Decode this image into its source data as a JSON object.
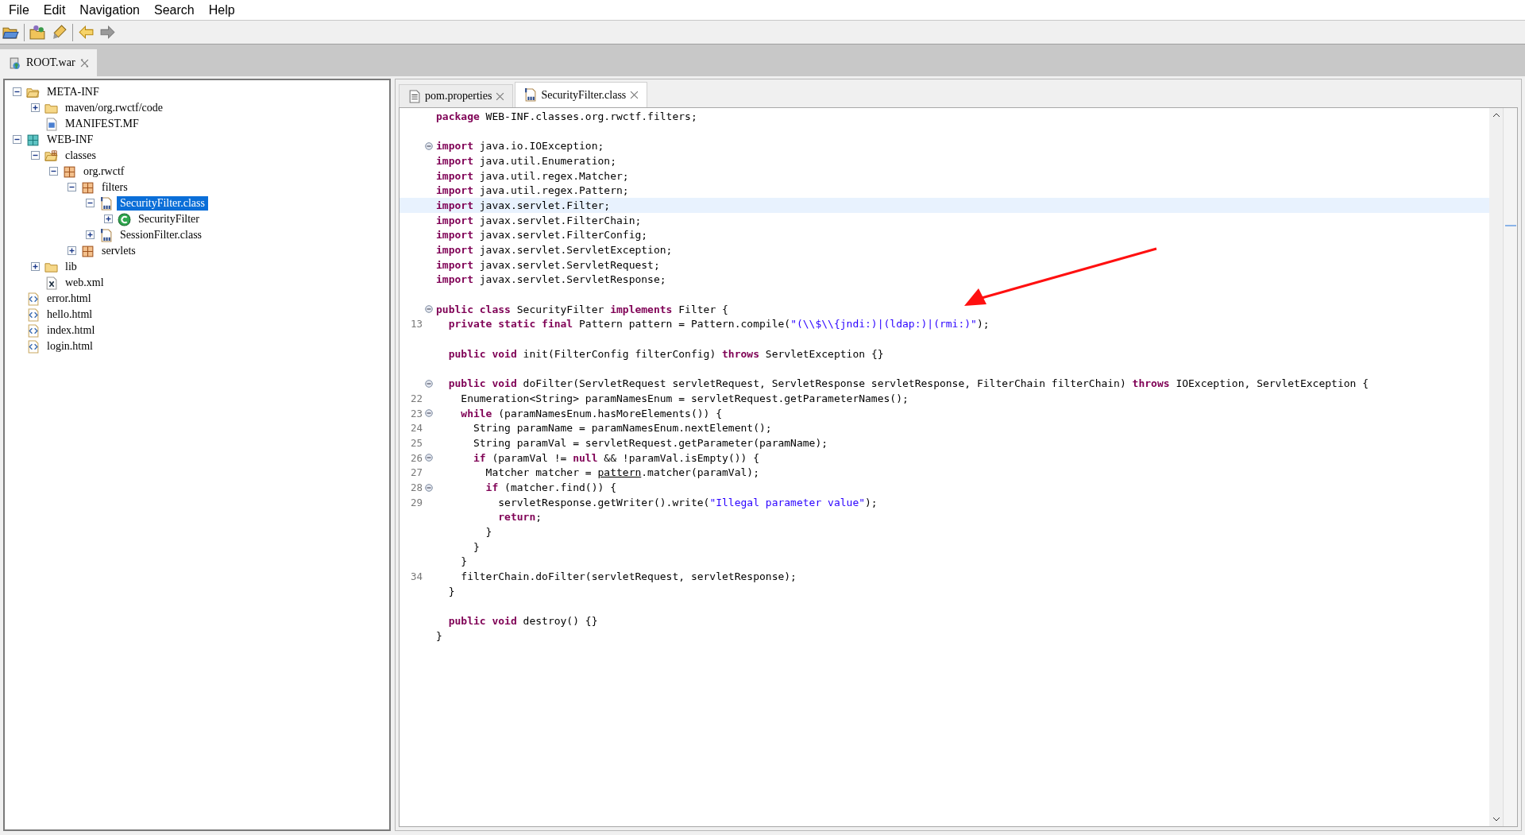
{
  "menu": [
    "File",
    "Edit",
    "Navigation",
    "Search",
    "Help"
  ],
  "toolbar": [
    {
      "kind": "open",
      "disabled": false
    },
    {
      "kind": "open-type",
      "disabled": false
    },
    {
      "kind": "declaration",
      "disabled": false
    },
    {
      "kind": "back",
      "disabled": false
    },
    {
      "kind": "forward",
      "disabled": true
    }
  ],
  "left_tabs": [
    {
      "label": "ROOT.war",
      "selected": true
    }
  ],
  "tree": [
    {
      "label": "META-INF",
      "kind": "folder",
      "expanded": true,
      "selected": false,
      "children": [
        {
          "label": "maven/org.rwctf/code",
          "kind": "folder",
          "expanded": false,
          "selected": false
        },
        {
          "label": "MANIFEST.MF",
          "kind": "manifest",
          "selected": false
        }
      ]
    },
    {
      "label": "WEB-INF",
      "kind": "webinf",
      "expanded": true,
      "selected": false,
      "children": [
        {
          "label": "classes",
          "kind": "classes",
          "expanded": true,
          "selected": false,
          "children": [
            {
              "label": "org.rwctf",
              "kind": "package",
              "expanded": true,
              "selected": false,
              "children": [
                {
                  "label": "filters",
                  "kind": "package",
                  "expanded": true,
                  "selected": false,
                  "children": [
                    {
                      "label": "SecurityFilter.class",
                      "kind": "classfile",
                      "expanded": true,
                      "selected": true,
                      "children": [
                        {
                          "label": "SecurityFilter",
                          "kind": "class",
                          "expanded": false,
                          "selected": false
                        }
                      ]
                    },
                    {
                      "label": "SessionFilter.class",
                      "kind": "classfile",
                      "expanded": false,
                      "selected": false
                    }
                  ]
                },
                {
                  "label": "servlets",
                  "kind": "package",
                  "expanded": false,
                  "selected": false
                }
              ]
            }
          ]
        },
        {
          "label": "lib",
          "kind": "folder",
          "expanded": false,
          "selected": false
        },
        {
          "label": "web.xml",
          "kind": "xml",
          "selected": false
        }
      ]
    },
    {
      "label": "error.html",
      "kind": "html",
      "selected": false
    },
    {
      "label": "hello.html",
      "kind": "html",
      "selected": false
    },
    {
      "label": "index.html",
      "kind": "html",
      "selected": false
    },
    {
      "label": "login.html",
      "kind": "html",
      "selected": false
    }
  ],
  "editor_tabs": [
    {
      "label": "pom.properties",
      "kind": "text",
      "selected": false
    },
    {
      "label": "SecurityFilter.class",
      "kind": "classfile",
      "selected": true
    }
  ],
  "code": [
    {
      "kind": "code",
      "segments": [
        {
          "t": "package",
          "kind": "kw"
        },
        {
          "t": " WEB-INF.classes.org.rwctf.filters;",
          "kind": "plain"
        }
      ]
    },
    {
      "kind": "blank"
    },
    {
      "kind": "code",
      "fold": true,
      "segments": [
        {
          "t": "import",
          "kind": "kw"
        },
        {
          "t": " java.io.IOException;",
          "kind": "plain"
        }
      ]
    },
    {
      "kind": "code",
      "segments": [
        {
          "t": "import",
          "kind": "kw"
        },
        {
          "t": " java.util.Enumeration;",
          "kind": "plain"
        }
      ]
    },
    {
      "kind": "code",
      "segments": [
        {
          "t": "import",
          "kind": "kw"
        },
        {
          "t": " java.util.regex.Matcher;",
          "kind": "plain"
        }
      ]
    },
    {
      "kind": "code",
      "segments": [
        {
          "t": "import",
          "kind": "kw"
        },
        {
          "t": " java.util.regex.Pattern;",
          "kind": "plain"
        }
      ]
    },
    {
      "kind": "code",
      "current": true,
      "segments": [
        {
          "t": "import",
          "kind": "kw"
        },
        {
          "t": " javax.servlet.Filter;",
          "kind": "plain"
        }
      ]
    },
    {
      "kind": "code",
      "segments": [
        {
          "t": "import",
          "kind": "kw"
        },
        {
          "t": " javax.servlet.FilterChain;",
          "kind": "plain"
        }
      ]
    },
    {
      "kind": "code",
      "segments": [
        {
          "t": "import",
          "kind": "kw"
        },
        {
          "t": " javax.servlet.FilterConfig;",
          "kind": "plain"
        }
      ]
    },
    {
      "kind": "code",
      "segments": [
        {
          "t": "import",
          "kind": "kw"
        },
        {
          "t": " javax.servlet.ServletException;",
          "kind": "plain"
        }
      ]
    },
    {
      "kind": "code",
      "segments": [
        {
          "t": "import",
          "kind": "kw"
        },
        {
          "t": " javax.servlet.ServletRequest;",
          "kind": "plain"
        }
      ]
    },
    {
      "kind": "code",
      "segments": [
        {
          "t": "import",
          "kind": "kw"
        },
        {
          "t": " javax.servlet.ServletResponse;",
          "kind": "plain"
        }
      ]
    },
    {
      "kind": "blank"
    },
    {
      "kind": "code",
      "fold": true,
      "segments": [
        {
          "t": "public class",
          "kind": "kw"
        },
        {
          "t": " SecurityFilter ",
          "kind": "plain"
        },
        {
          "t": "implements",
          "kind": "kw"
        },
        {
          "t": " Filter {",
          "kind": "plain"
        }
      ]
    },
    {
      "kind": "code",
      "number": "13",
      "segments": [
        {
          "t": "  private static final",
          "kind": "kw"
        },
        {
          "t": " Pattern pattern = Pattern.compile(",
          "kind": "plain"
        },
        {
          "t": "\"(\\\\$\\\\{jndi:)|(ldap:)|(rmi:)\"",
          "kind": "str"
        },
        {
          "t": ");",
          "kind": "plain"
        }
      ]
    },
    {
      "kind": "blank"
    },
    {
      "kind": "code",
      "segments": [
        {
          "t": "  public void",
          "kind": "kw"
        },
        {
          "t": " init(FilterConfig filterConfig) ",
          "kind": "plain"
        },
        {
          "t": "throws",
          "kind": "kw"
        },
        {
          "t": " ServletException {}",
          "kind": "plain"
        }
      ]
    },
    {
      "kind": "blank"
    },
    {
      "kind": "code",
      "fold": true,
      "segments": [
        {
          "t": "  public void",
          "kind": "kw"
        },
        {
          "t": " doFilter(ServletRequest servletRequest, ServletResponse servletResponse, FilterChain filterChain) ",
          "kind": "plain"
        },
        {
          "t": "throws",
          "kind": "kw"
        },
        {
          "t": " IOException, ServletException {",
          "kind": "plain"
        }
      ]
    },
    {
      "kind": "code",
      "number": "22",
      "segments": [
        {
          "t": "    Enumeration<String> paramNamesEnum = servletRequest.getParameterNames();",
          "kind": "plain"
        }
      ]
    },
    {
      "kind": "code",
      "number": "23",
      "fold": true,
      "segments": [
        {
          "t": "    while",
          "kind": "kw"
        },
        {
          "t": " (paramNamesEnum.hasMoreElements()) {",
          "kind": "plain"
        }
      ]
    },
    {
      "kind": "code",
      "number": "24",
      "segments": [
        {
          "t": "      String paramName = paramNamesEnum.nextElement();",
          "kind": "plain"
        }
      ]
    },
    {
      "kind": "code",
      "number": "25",
      "segments": [
        {
          "t": "      String paramVal = servletRequest.getParameter(paramName);",
          "kind": "plain"
        }
      ]
    },
    {
      "kind": "code",
      "number": "26",
      "fold": true,
      "segments": [
        {
          "t": "      if",
          "kind": "kw"
        },
        {
          "t": " (paramVal != ",
          "kind": "plain"
        },
        {
          "t": "null",
          "kind": "kw"
        },
        {
          "t": " && !paramVal.isEmpty()) {",
          "kind": "plain"
        }
      ]
    },
    {
      "kind": "code",
      "number": "27",
      "segments": [
        {
          "t": "        Matcher matcher = ",
          "kind": "plain"
        },
        {
          "t": "pattern",
          "kind": "ref"
        },
        {
          "t": ".matcher(paramVal);",
          "kind": "plain"
        }
      ]
    },
    {
      "kind": "code",
      "number": "28",
      "fold": true,
      "segments": [
        {
          "t": "        if",
          "kind": "kw"
        },
        {
          "t": " (matcher.find()) {",
          "kind": "plain"
        }
      ]
    },
    {
      "kind": "code",
      "number": "29",
      "segments": [
        {
          "t": "          servletResponse.getWriter().write(",
          "kind": "plain"
        },
        {
          "t": "\"Illegal parameter value\"",
          "kind": "str"
        },
        {
          "t": ");",
          "kind": "plain"
        }
      ]
    },
    {
      "kind": "code",
      "segments": [
        {
          "t": "          return",
          "kind": "kw"
        },
        {
          "t": ";",
          "kind": "plain"
        }
      ]
    },
    {
      "kind": "code",
      "segments": [
        {
          "t": "        }",
          "kind": "plain"
        }
      ]
    },
    {
      "kind": "code",
      "segments": [
        {
          "t": "      }",
          "kind": "plain"
        }
      ]
    },
    {
      "kind": "code",
      "segments": [
        {
          "t": "    }",
          "kind": "plain"
        }
      ]
    },
    {
      "kind": "code",
      "number": "34",
      "segments": [
        {
          "t": "    filterChain.doFilter(servletRequest, servletResponse);",
          "kind": "plain"
        }
      ]
    },
    {
      "kind": "code",
      "segments": [
        {
          "t": "  }",
          "kind": "plain"
        }
      ]
    },
    {
      "kind": "blank"
    },
    {
      "kind": "code",
      "segments": [
        {
          "t": "  public void",
          "kind": "kw"
        },
        {
          "t": " destroy() {}",
          "kind": "plain"
        }
      ]
    },
    {
      "kind": "code",
      "segments": [
        {
          "t": "}",
          "kind": "plain"
        }
      ]
    }
  ]
}
